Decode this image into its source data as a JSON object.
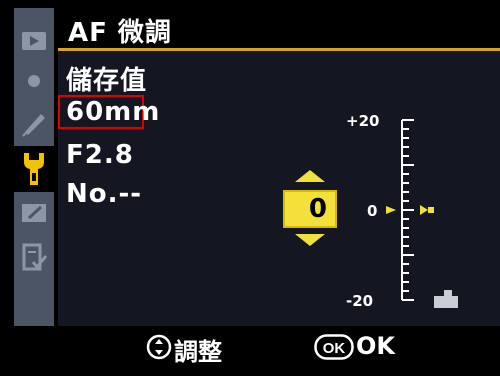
{
  "header": {
    "title": "AF 微調"
  },
  "menu": {
    "section_label": "儲存值",
    "lens_focal": "60mm",
    "lens_aperture": "F2.8",
    "lens_number": "No.--"
  },
  "adjust": {
    "value": "0",
    "level": 0
  },
  "scale": {
    "max_label": "+20",
    "zero_label": "0",
    "min_label": "-20"
  },
  "footer": {
    "adjust_label": "調整",
    "ok_label": "OK"
  },
  "colors": {
    "accent": "#d9a321",
    "selection": "#e00000",
    "value_box": "#f2e13a",
    "marker": "#f2e13a"
  },
  "tabs": [
    {
      "icon": "play-icon",
      "active": false
    },
    {
      "icon": "camera-icon",
      "active": false
    },
    {
      "icon": "pencil-icon",
      "active": false
    },
    {
      "icon": "wrench-icon",
      "active": true
    },
    {
      "icon": "retouch-icon",
      "active": false
    },
    {
      "icon": "my-menu-icon",
      "active": false
    }
  ]
}
